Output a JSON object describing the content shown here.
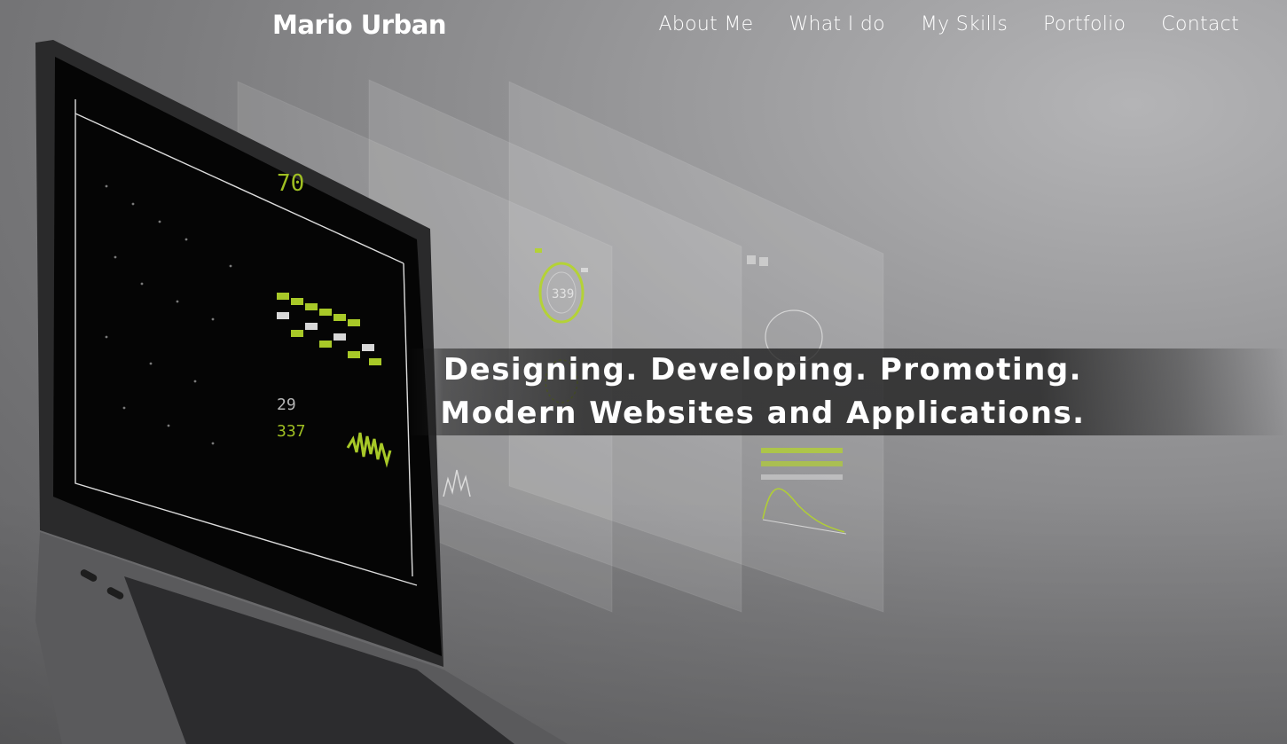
{
  "header": {
    "brand": "Mario Urban",
    "nav": [
      {
        "label": "About Me"
      },
      {
        "label": "What I do"
      },
      {
        "label": "My Skills"
      },
      {
        "label": "Portfolio"
      },
      {
        "label": "Contact"
      }
    ]
  },
  "hero": {
    "line1": "Designing. Developing. Promoting.",
    "line2": "Modern Websites and Applications.",
    "screen_readouts": [
      "70",
      "339",
      "29",
      "337"
    ]
  },
  "colors": {
    "accent_green": "#b5d62a",
    "text": "#ffffff",
    "background": "#8a8a8c"
  }
}
